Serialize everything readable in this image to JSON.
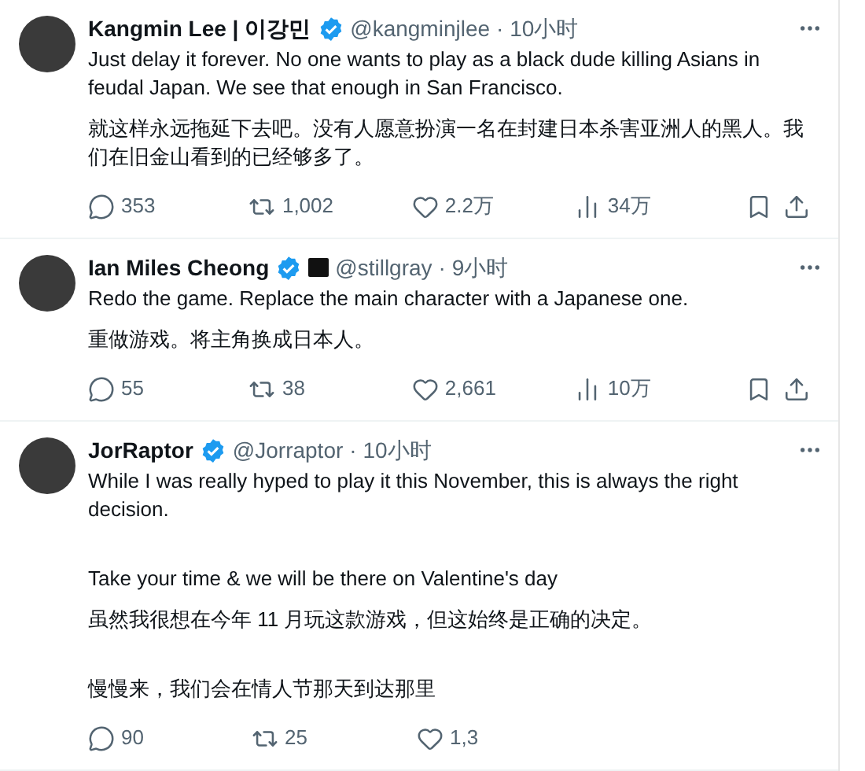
{
  "tweets": [
    {
      "name": "Kangmin Lee | 이강민",
      "verified": true,
      "affiliate": false,
      "handle": "@kangminjlee",
      "time": "· 10小时",
      "paragraphs": [
        {
          "kind": "text",
          "text": "Just delay it forever. No one wants to play as a black dude killing Asians in feudal Japan. We see that enough in San Francisco."
        },
        {
          "kind": "text",
          "text": "就这样永远拖延下去吧。没有人愿意扮演一名在封建日本杀害亚洲人的黑人。我们在旧金山看到的已经够多了。"
        }
      ],
      "actions": [
        {
          "kind": "reply",
          "count": "353"
        },
        {
          "kind": "repost",
          "count": "1,002"
        },
        {
          "kind": "like",
          "count": "2.2万"
        },
        {
          "kind": "views",
          "count": "34万"
        },
        {
          "kind": "bookmark"
        },
        {
          "kind": "share"
        }
      ]
    },
    {
      "name": "Ian Miles Cheong",
      "verified": true,
      "affiliate": true,
      "handle": "@stillgray",
      "time": "· 9小时",
      "paragraphs": [
        {
          "kind": "text",
          "text": "Redo the game. Replace the main character with a Japanese one."
        },
        {
          "kind": "text",
          "text": "重做游戏。将主角换成日本人。"
        }
      ],
      "actions": [
        {
          "kind": "reply",
          "count": "55"
        },
        {
          "kind": "repost",
          "count": "38"
        },
        {
          "kind": "like",
          "count": "2,661"
        },
        {
          "kind": "views",
          "count": "10万"
        },
        {
          "kind": "bookmark"
        },
        {
          "kind": "share"
        }
      ]
    },
    {
      "name": "JorRaptor",
      "verified": true,
      "affiliate": false,
      "handle": "@Jorraptor",
      "time": "· 10小时",
      "paragraphs": [
        {
          "kind": "text",
          "text": "While I was really hyped to play it this November, this is always the right decision."
        },
        {
          "kind": "blank"
        },
        {
          "kind": "text",
          "text": "Take your time & we will be there on Valentine's day"
        },
        {
          "kind": "text",
          "text": "虽然我很想在今年 11 月玩这款游戏，但这始终是正确的决定。"
        },
        {
          "kind": "blank"
        },
        {
          "kind": "text",
          "text": "慢慢来，我们会在情人节那天到达那里"
        }
      ],
      "actions": [
        {
          "kind": "reply",
          "count": "90"
        },
        {
          "kind": "repost",
          "count": "25"
        },
        {
          "kind": "like",
          "count": "1,3"
        }
      ]
    }
  ]
}
